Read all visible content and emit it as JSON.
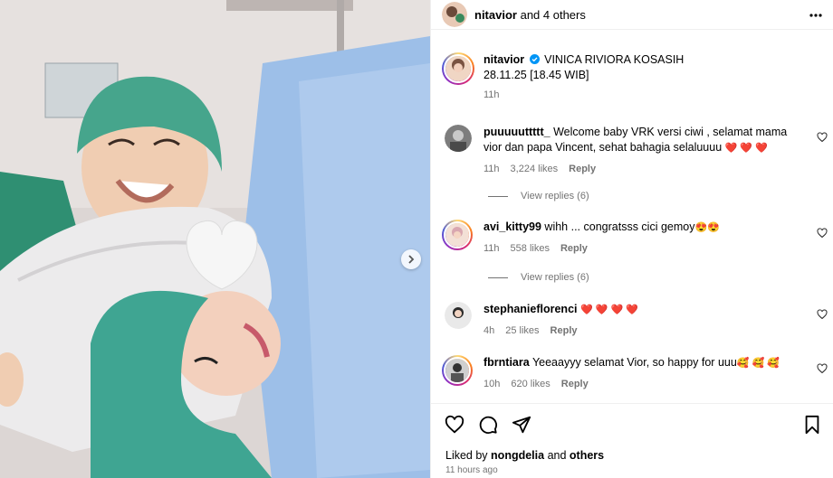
{
  "header": {
    "username": "nitavior",
    "others_text": "and 4 others"
  },
  "caption": {
    "username": "nitavior",
    "text_line1": "VINICA RIVIORA KOSASIH",
    "text_line2": "28.11.25 [18.45 WIB]",
    "time": "11h"
  },
  "comments": [
    {
      "username": "puuuuuttttt_",
      "text": "Welcome baby VRK versi ciwi , selamat mama vior dan papa Vincent, sehat bahagia selaluuuu",
      "emoji": "❤️ ❤️ ❤️",
      "time": "11h",
      "likes": "3,224 likes",
      "reply": "Reply",
      "view_replies": "View replies (6)"
    },
    {
      "username": "avi_kitty99",
      "text": "wihh ... congratsss cici gemoy",
      "emoji": "😍😍",
      "time": "11h",
      "likes": "558 likes",
      "reply": "Reply",
      "view_replies": "View replies (6)"
    },
    {
      "username": "stephanieflorenci",
      "text": "",
      "emoji": "❤️ ❤️ ❤️ ❤️",
      "time": "4h",
      "likes": "25 likes",
      "reply": "Reply"
    },
    {
      "username": "fbrntiara",
      "text": "Yeeaayyy selamat Vior, so happy for uuu",
      "emoji": "🥰 🥰 🥰",
      "time": "10h",
      "likes": "620 likes",
      "reply": "Reply"
    }
  ],
  "footer": {
    "liked_prefix": "Liked by",
    "liked_user": "nongdelia",
    "liked_and": "and",
    "liked_others": "others",
    "time_ago": "11 hours ago"
  },
  "colors": {
    "heart": "#e0245e",
    "verified": "#0095f6",
    "cap": "#3fa592",
    "drape": "#8fb8e6"
  }
}
